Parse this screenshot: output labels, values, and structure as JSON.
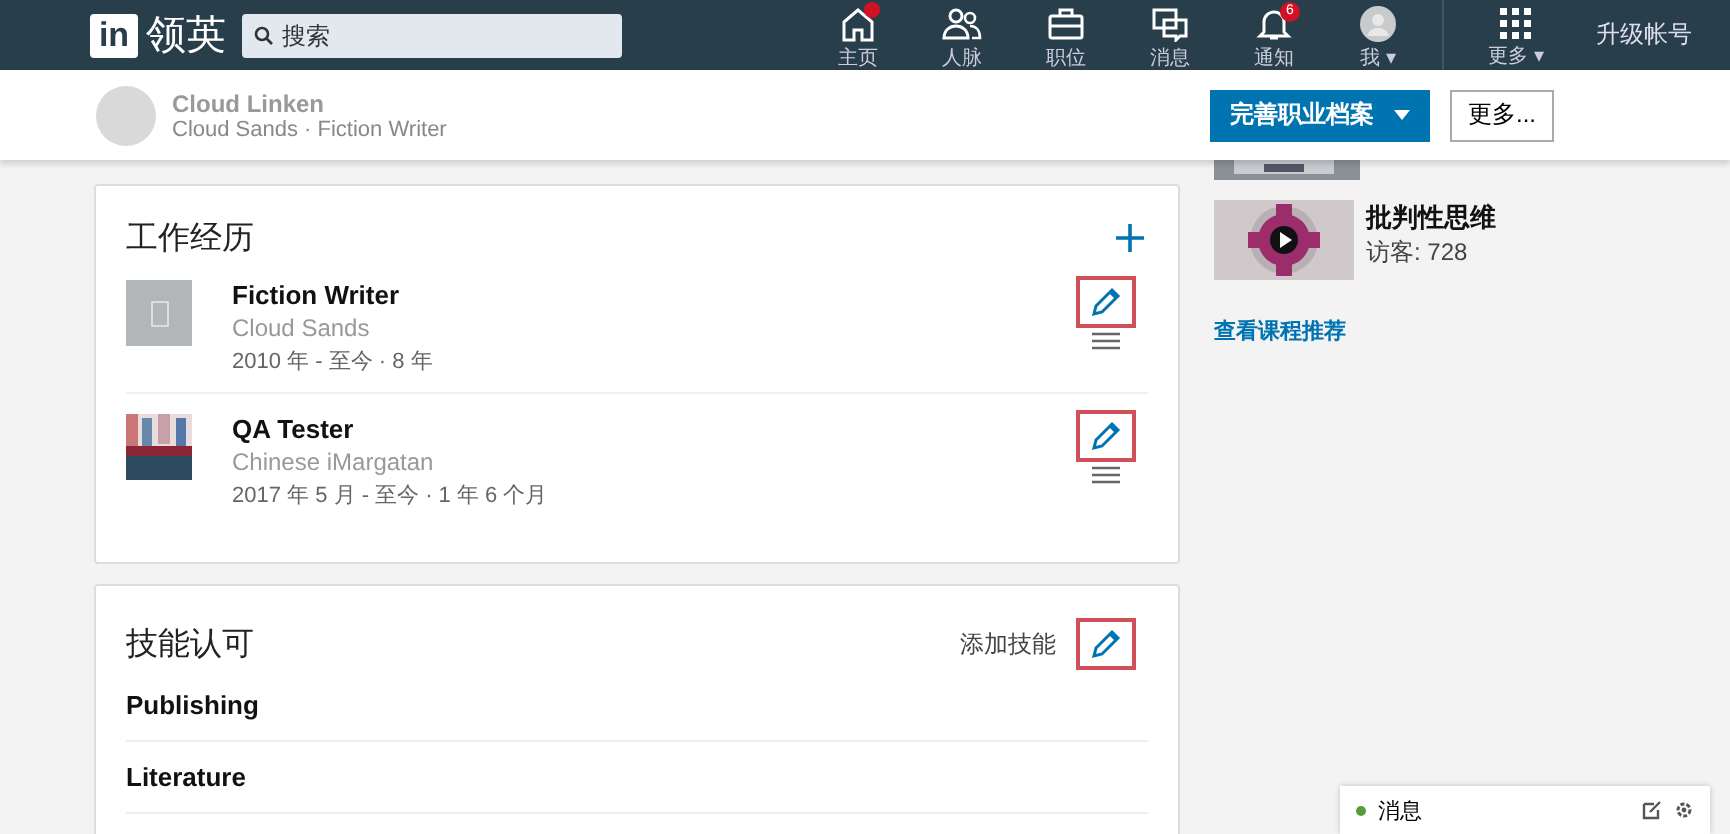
{
  "nav": {
    "logo_mark": "in",
    "logo_text": "领英",
    "search": {
      "placeholder": "搜索"
    },
    "items": [
      {
        "kind": "home",
        "label": "主页",
        "alert_dot": true
      },
      {
        "kind": "people",
        "label": "人脉",
        "alert_dot": false
      },
      {
        "kind": "briefcase",
        "label": "职位",
        "alert_dot": false
      },
      {
        "kind": "chat",
        "label": "消息",
        "alert_dot": false
      },
      {
        "kind": "bell",
        "label": "通知",
        "alert_dot": false,
        "badge": "6"
      },
      {
        "kind": "avatar",
        "label": "我",
        "alert_dot": false,
        "caret": "▾"
      }
    ],
    "more": {
      "label": "更多",
      "caret": "▾"
    },
    "upgrade": "升级帐号"
  },
  "profile_bar": {
    "name": "Cloud Linken",
    "headline": "Cloud Sands · Fiction Writer",
    "primary_button": "完善职业档案",
    "more_button": "更多..."
  },
  "experience": {
    "title": "工作经历",
    "items": [
      {
        "title": "Fiction Writer",
        "company": "Cloud Sands",
        "dates": "2010 年 - 至今 · 8 年",
        "kind": "placeholder",
        "highlighted": true
      },
      {
        "title": "QA Tester",
        "company": "Chinese iMargatan",
        "dates": "2017 年 5 月 - 至今 · 1 年 6 个月",
        "kind": "picture",
        "highlighted": true
      }
    ]
  },
  "skills": {
    "title": "技能认可",
    "add_label": "添加技能",
    "highlighted": true,
    "items": [
      "Publishing",
      "Literature"
    ]
  },
  "sidebar": {
    "courses": [
      {
        "title": "批判性思维",
        "viewers": "访客: 728"
      }
    ],
    "link": "查看课程推荐"
  },
  "messaging": {
    "label": "消息"
  }
}
